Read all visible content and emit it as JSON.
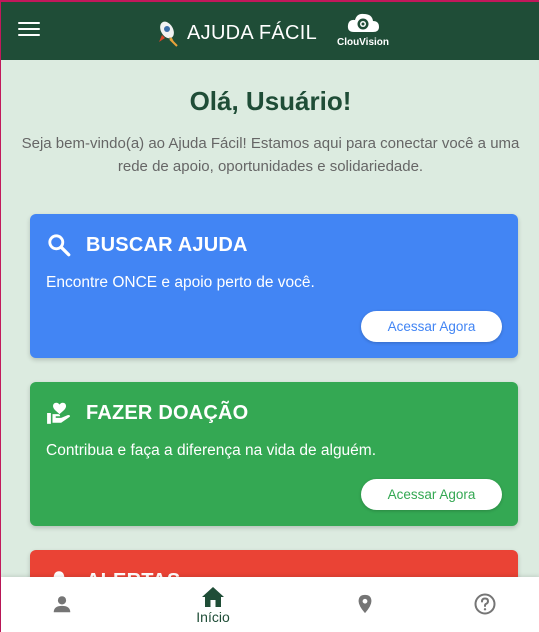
{
  "appbar": {
    "menu_icon": "menu-icon",
    "brand_icon": "rocket-logo-icon",
    "title": "AJUDA FÁCIL",
    "partner_icon": "cloud-eye-logo-icon",
    "partner_label": "ClouVision"
  },
  "hero": {
    "greeting": "Olá, Usuário!",
    "intro": "Seja bem-vindo(a) ao Ajuda Fácil! Estamos aqui para conectar você a uma rede de apoio, oportunidades e solidariedade."
  },
  "cards": [
    {
      "icon": "search-icon",
      "title": "BUSCAR AJUDA",
      "text": "Encontre ONCE e apoio perto de você.",
      "button": "Acessar Agora",
      "color": "#4285f4"
    },
    {
      "icon": "volunteer-hand-heart-icon",
      "title": "FAZER DOAÇÃO",
      "text": "Contribua e faça a diferença na vida de alguém.",
      "button": "Acessar Agora",
      "color": "#34a853"
    },
    {
      "icon": "bell-icon",
      "title": "ALERTAS",
      "color": "#ea4335"
    }
  ],
  "bottom_nav": {
    "profile_icon": "person-icon",
    "home_icon": "home-icon",
    "home_label": "Início",
    "map_icon": "location-pin-icon",
    "help_icon": "help-circle-icon",
    "active_color": "#1f4d37"
  },
  "colors": {
    "appbar": "#1f4d37",
    "background": "#dcebe0"
  }
}
